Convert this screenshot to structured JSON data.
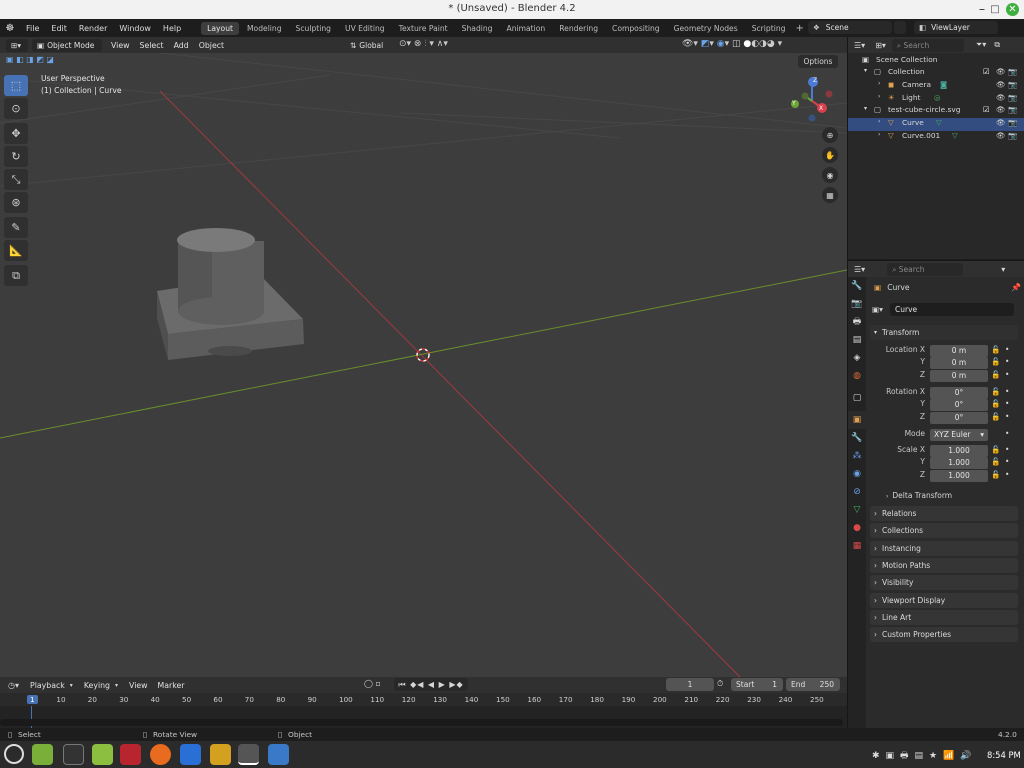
{
  "window": {
    "title": "* (Unsaved) - Blender 4.2"
  },
  "menus": [
    "File",
    "Edit",
    "Render",
    "Window",
    "Help"
  ],
  "workspaces": [
    "Layout",
    "Modeling",
    "Sculpting",
    "UV Editing",
    "Texture Paint",
    "Shading",
    "Animation",
    "Rendering",
    "Compositing",
    "Geometry Nodes",
    "Scripting"
  ],
  "active_workspace": "Layout",
  "scene": {
    "name": "Scene",
    "view_layer": "ViewLayer"
  },
  "viewport_header": {
    "mode": "Object Mode",
    "menus": [
      "View",
      "Select",
      "Add",
      "Object"
    ],
    "orientation": "Global"
  },
  "viewport": {
    "perspective_label": "User Perspective",
    "collection_label": "(1) Collection | Curve",
    "options_label": "Options",
    "gizmo_axes": [
      "Z",
      "Y",
      "X"
    ]
  },
  "outliner": {
    "search_placeholder": "Search",
    "rows": [
      {
        "label": "Scene Collection"
      },
      {
        "label": "Collection"
      },
      {
        "label": "Camera"
      },
      {
        "label": "Light"
      },
      {
        "label": "test-cube-circle.svg"
      },
      {
        "label": "Curve"
      },
      {
        "label": "Curve.001"
      }
    ]
  },
  "properties": {
    "search_placeholder": "Search",
    "object_name": "Curve",
    "datablock_name": "Curve",
    "transform": {
      "header": "Transform",
      "location_label": "Location X",
      "location": [
        "0 m",
        "0 m",
        "0 m"
      ],
      "rotation_label": "Rotation X",
      "rotation": [
        "0°",
        "0°",
        "0°"
      ],
      "mode_label": "Mode",
      "mode": "XYZ Euler",
      "scale_label": "Scale X",
      "scale": [
        "1.000",
        "1.000",
        "1.000"
      ],
      "y_label": "Y",
      "z_label": "Z",
      "delta": "Delta Transform"
    },
    "panels": [
      "Relations",
      "Collections",
      "Instancing",
      "Motion Paths",
      "Visibility",
      "Viewport Display",
      "Line Art",
      "Custom Properties"
    ]
  },
  "timeline": {
    "menus": [
      "Playback",
      "Keying",
      "View",
      "Marker"
    ],
    "current_frame": "1",
    "start_label": "Start",
    "start": "1",
    "end_label": "End",
    "end": "250",
    "ticks": [
      "1",
      "10",
      "20",
      "30",
      "40",
      "50",
      "60",
      "70",
      "80",
      "90",
      "100",
      "110",
      "120",
      "130",
      "140",
      "150",
      "160",
      "170",
      "180",
      "190",
      "200",
      "210",
      "220",
      "230",
      "240",
      "250"
    ]
  },
  "statusbar": {
    "items": [
      "Select",
      "Rotate View",
      "Object"
    ],
    "version": "4.2.0"
  },
  "taskbar": {
    "time": "8:54 PM"
  }
}
